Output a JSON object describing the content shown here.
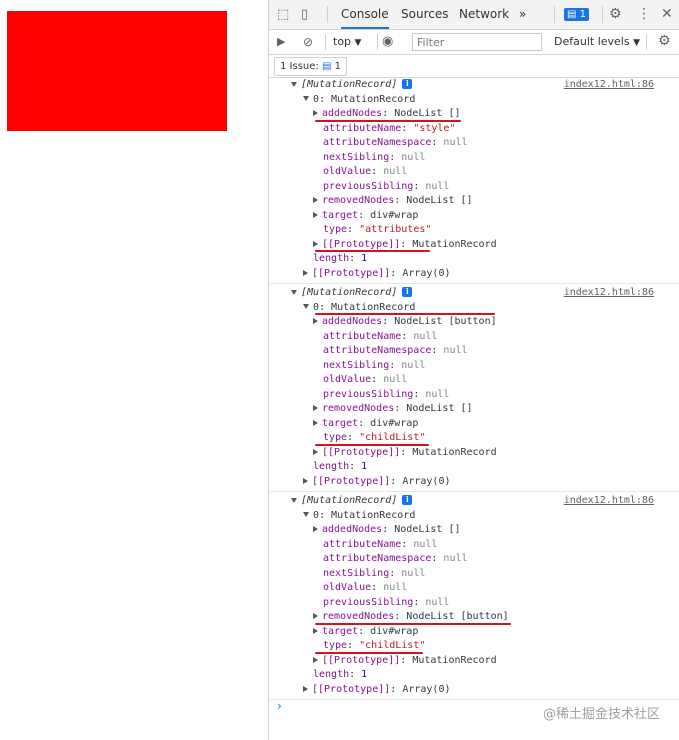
{
  "toolbar": {
    "tabs": [
      "Console",
      "Sources",
      "Network"
    ],
    "more": "»",
    "message_count": "1"
  },
  "filterbar": {
    "context": "top",
    "filter_placeholder": "Filter",
    "levels": "Default levels"
  },
  "issues": {
    "label": "1 Issue:",
    "count": "1"
  },
  "groups": [
    {
      "header": "[MutationRecord]",
      "source": "index12.html:86",
      "record": "0: MutationRecord",
      "lines": [
        {
          "k": "addedNodes",
          "v": "NodeList []",
          "c": "val",
          "exp": true
        },
        {
          "k": "attributeName",
          "v": "\"style\"",
          "c": "str",
          "exp": false
        },
        {
          "k": "attributeNamespace",
          "v": "null",
          "c": "nul",
          "exp": false
        },
        {
          "k": "nextSibling",
          "v": "null",
          "c": "nul",
          "exp": false
        },
        {
          "k": "oldValue",
          "v": "null",
          "c": "nul",
          "exp": false
        },
        {
          "k": "previousSibling",
          "v": "null",
          "c": "nul",
          "exp": false
        },
        {
          "k": "removedNodes",
          "v": "NodeList []",
          "c": "val",
          "exp": true
        },
        {
          "k": "target",
          "v": "div#wrap",
          "c": "val",
          "exp": true
        },
        {
          "k": "type",
          "v": "\"attributes\"",
          "c": "str",
          "exp": false
        },
        {
          "k": "[[Prototype]]",
          "v": "MutationRecord",
          "c": "val",
          "exp": true
        }
      ],
      "length": "1",
      "proto": "Array(0)"
    },
    {
      "header": "[MutationRecord]",
      "source": "index12.html:86",
      "record": "0: MutationRecord",
      "lines": [
        {
          "k": "addedNodes",
          "v": "NodeList [button]",
          "c": "val",
          "exp": true
        },
        {
          "k": "attributeName",
          "v": "null",
          "c": "nul",
          "exp": false
        },
        {
          "k": "attributeNamespace",
          "v": "null",
          "c": "nul",
          "exp": false
        },
        {
          "k": "nextSibling",
          "v": "null",
          "c": "nul",
          "exp": false
        },
        {
          "k": "oldValue",
          "v": "null",
          "c": "nul",
          "exp": false
        },
        {
          "k": "previousSibling",
          "v": "null",
          "c": "nul",
          "exp": false
        },
        {
          "k": "removedNodes",
          "v": "NodeList []",
          "c": "val",
          "exp": true
        },
        {
          "k": "target",
          "v": "div#wrap",
          "c": "val",
          "exp": true
        },
        {
          "k": "type",
          "v": "\"childList\"",
          "c": "str",
          "exp": false
        },
        {
          "k": "[[Prototype]]",
          "v": "MutationRecord",
          "c": "val",
          "exp": true
        }
      ],
      "length": "1",
      "proto": "Array(0)"
    },
    {
      "header": "[MutationRecord]",
      "source": "index12.html:86",
      "record": "0: MutationRecord",
      "lines": [
        {
          "k": "addedNodes",
          "v": "NodeList []",
          "c": "val",
          "exp": true
        },
        {
          "k": "attributeName",
          "v": "null",
          "c": "nul",
          "exp": false
        },
        {
          "k": "attributeNamespace",
          "v": "null",
          "c": "nul",
          "exp": false
        },
        {
          "k": "nextSibling",
          "v": "null",
          "c": "nul",
          "exp": false
        },
        {
          "k": "oldValue",
          "v": "null",
          "c": "nul",
          "exp": false
        },
        {
          "k": "previousSibling",
          "v": "null",
          "c": "nul",
          "exp": false
        },
        {
          "k": "removedNodes",
          "v": "NodeList [button]",
          "c": "val",
          "exp": true
        },
        {
          "k": "target",
          "v": "div#wrap",
          "c": "val",
          "exp": true
        },
        {
          "k": "type",
          "v": "\"childList\"",
          "c": "str",
          "exp": false
        },
        {
          "k": "[[Prototype]]",
          "v": "MutationRecord",
          "c": "val",
          "exp": true
        }
      ],
      "length": "1",
      "proto": "Array(0)"
    }
  ],
  "prompt": "›",
  "watermark": "@稀土掘金技术社区",
  "colors": {
    "box": "#ff0000",
    "accent": "#1a73e8",
    "annotation": "#d4141c"
  }
}
